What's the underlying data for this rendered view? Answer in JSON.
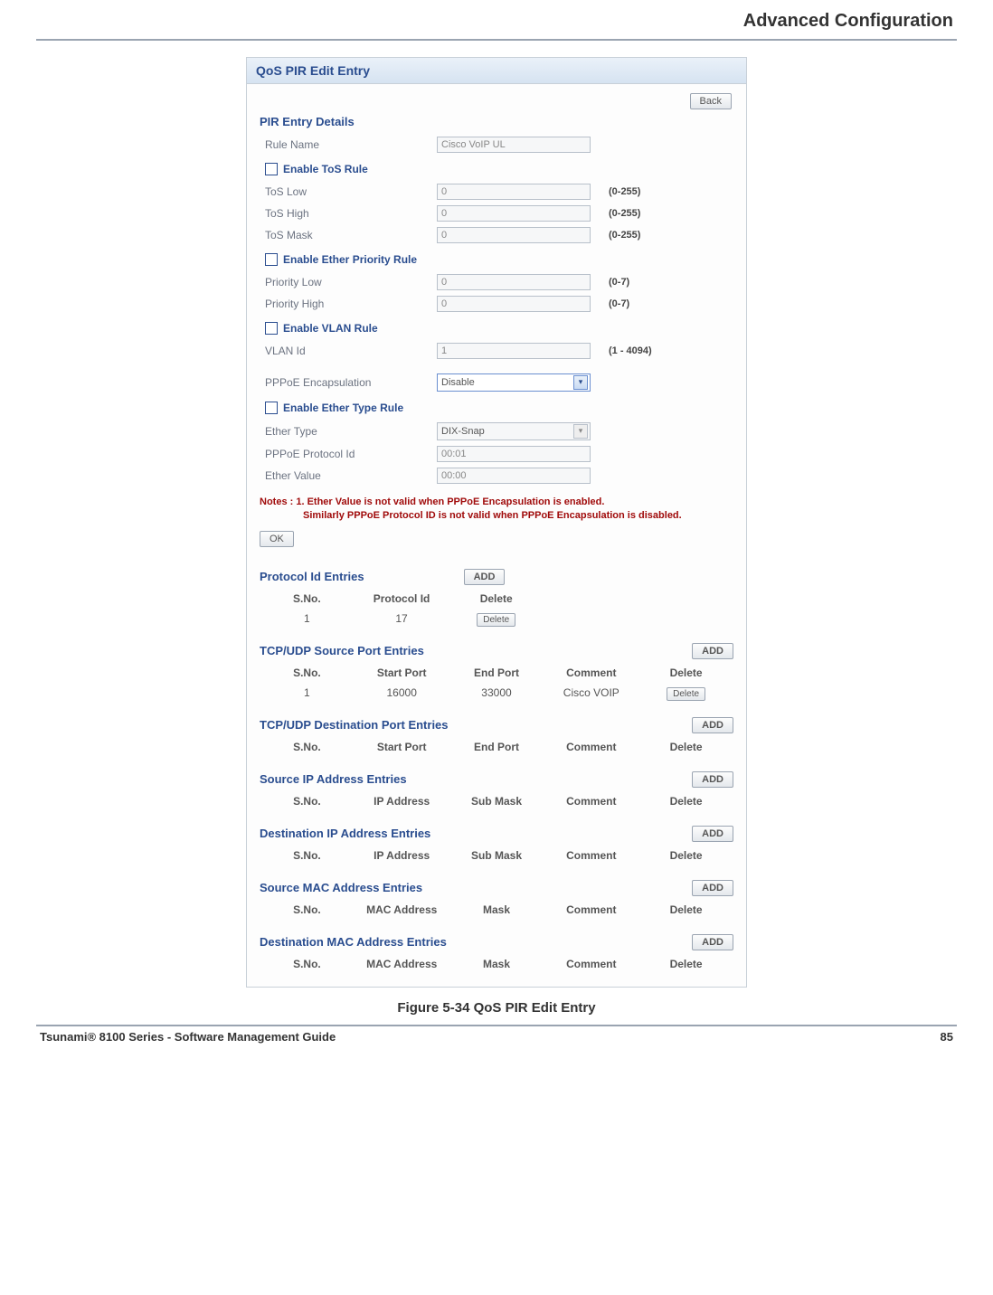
{
  "doc": {
    "header": "Advanced Configuration",
    "footer_left": "Tsunami® 8100 Series - Software Management Guide",
    "footer_right": "85",
    "caption": "Figure 5-34 QoS PIR Edit Entry"
  },
  "panel": {
    "title": "QoS PIR Edit Entry",
    "back": "Back",
    "pir_details_title": "PIR Entry Details",
    "rule_name_label": "Rule Name",
    "rule_name_value": "Cisco VoIP UL",
    "tos": {
      "title": "Enable ToS Rule",
      "low_label": "ToS Low",
      "low_value": "0",
      "low_hint": "(0-255)",
      "high_label": "ToS High",
      "high_value": "0",
      "high_hint": "(0-255)",
      "mask_label": "ToS Mask",
      "mask_value": "0",
      "mask_hint": "(0-255)"
    },
    "etherprio": {
      "title": "Enable Ether Priority Rule",
      "low_label": "Priority Low",
      "low_value": "0",
      "low_hint": "(0-7)",
      "high_label": "Priority High",
      "high_value": "0",
      "high_hint": "(0-7)"
    },
    "vlan": {
      "title": "Enable VLAN Rule",
      "id_label": "VLAN Id",
      "id_value": "1",
      "id_hint": "(1 - 4094)"
    },
    "pppoe_encap_label": "PPPoE Encapsulation",
    "pppoe_encap_value": "Disable",
    "ethertype": {
      "title": "Enable Ether Type Rule",
      "type_label": "Ether Type",
      "type_value": "DIX-Snap",
      "proto_label": "PPPoE Protocol Id",
      "proto_value": "00:01",
      "value_label": "Ether Value",
      "value_value": "00:00"
    },
    "notes_line1": "Notes : 1. Ether Value is not valid when PPPoE Encapsulation is enabled.",
    "notes_line2": "Similarly PPPoE Protocol ID is not valid when PPPoE Encapsulation is disabled.",
    "ok": "OK",
    "add": "ADD",
    "delete": "Delete"
  },
  "tables": {
    "protocol": {
      "title": "Protocol Id Entries",
      "headers": {
        "sno": "S.No.",
        "pid": "Protocol Id",
        "del": "Delete"
      },
      "row": {
        "sno": "1",
        "pid": "17"
      }
    },
    "tcp_src": {
      "title": "TCP/UDP Source Port Entries",
      "headers": {
        "sno": "S.No.",
        "start": "Start Port",
        "end": "End Port",
        "comment": "Comment",
        "del": "Delete"
      },
      "row": {
        "sno": "1",
        "start": "16000",
        "end": "33000",
        "comment": "Cisco VOIP"
      }
    },
    "tcp_dst": {
      "title": "TCP/UDP Destination Port Entries",
      "headers": {
        "sno": "S.No.",
        "start": "Start Port",
        "end": "End Port",
        "comment": "Comment",
        "del": "Delete"
      }
    },
    "src_ip": {
      "title": "Source IP Address Entries",
      "headers": {
        "sno": "S.No.",
        "ip": "IP Address",
        "mask": "Sub Mask",
        "comment": "Comment",
        "del": "Delete"
      }
    },
    "dst_ip": {
      "title": "Destination IP Address Entries",
      "headers": {
        "sno": "S.No.",
        "ip": "IP Address",
        "mask": "Sub Mask",
        "comment": "Comment",
        "del": "Delete"
      }
    },
    "src_mac": {
      "title": "Source MAC Address Entries",
      "headers": {
        "sno": "S.No.",
        "mac": "MAC Address",
        "mask": "Mask",
        "comment": "Comment",
        "del": "Delete"
      }
    },
    "dst_mac": {
      "title": "Destination MAC Address Entries",
      "headers": {
        "sno": "S.No.",
        "mac": "MAC Address",
        "mask": "Mask",
        "comment": "Comment",
        "del": "Delete"
      }
    }
  }
}
